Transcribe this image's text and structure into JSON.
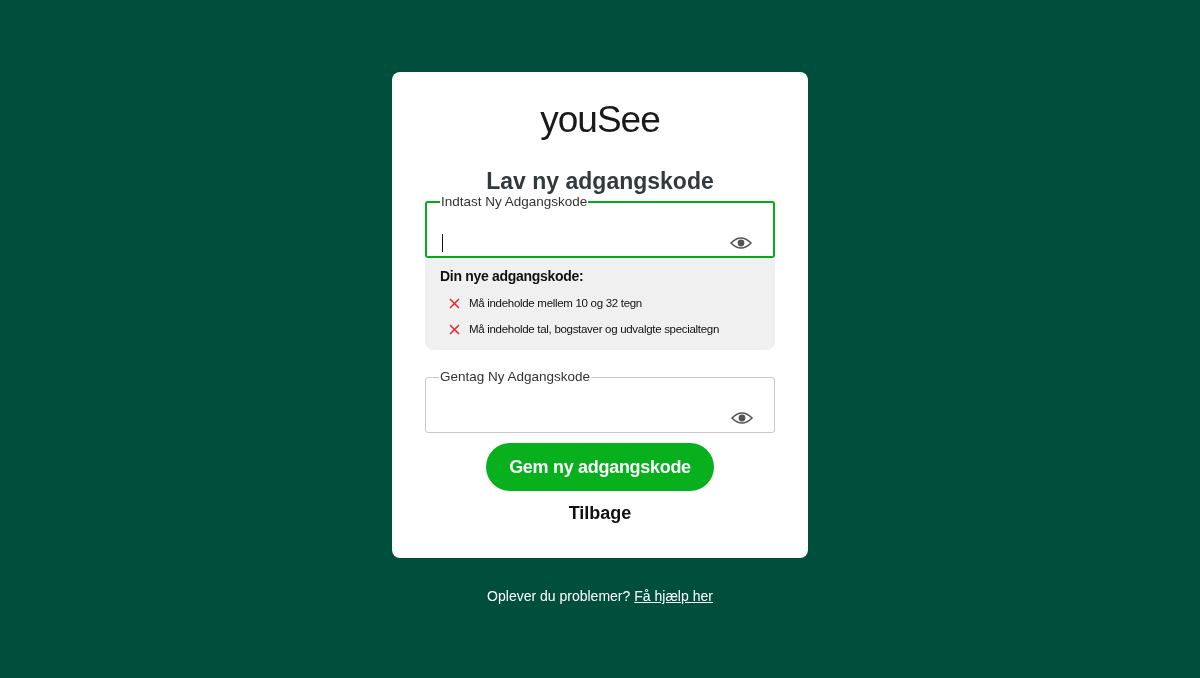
{
  "logo": "youSee",
  "title": "Lav ny adgangskode",
  "fields": [
    {
      "label": "Indtast Ny Adgangskode",
      "focused": true
    },
    {
      "label": "Gentag Ny Adgangskode",
      "focused": false
    }
  ],
  "requirements": {
    "heading": "Din nye adgangskode:",
    "items": [
      {
        "text": "Må indeholde mellem 10 og 32 tegn",
        "met": false
      },
      {
        "text": "Må indeholde tal, bogstaver og udvalgte specialtegn",
        "met": false
      }
    ]
  },
  "save_button": "Gem ny adgangskode",
  "back_link": "Tilbage",
  "footer": {
    "text": "Oplever du problemer?",
    "link": "Få hjælp her"
  }
}
